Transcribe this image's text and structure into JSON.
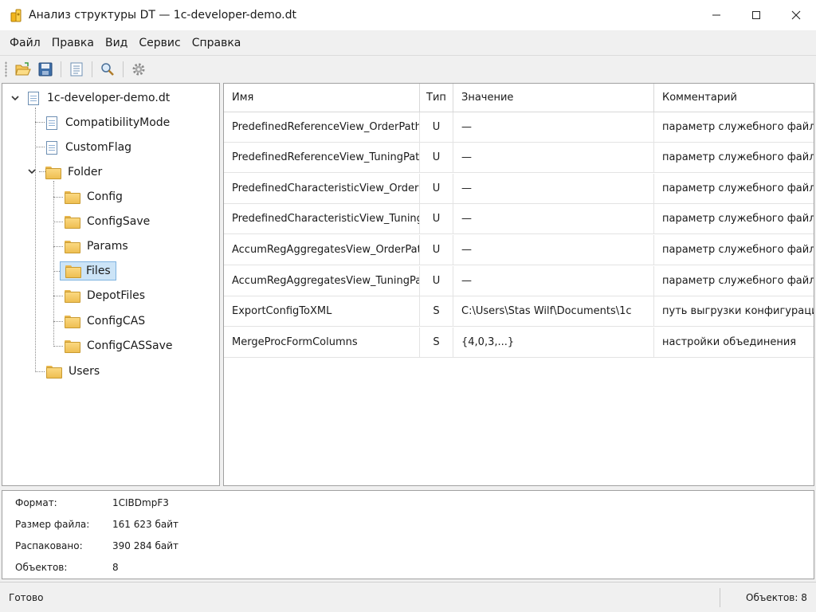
{
  "window": {
    "title": "Анализ структуры DT — 1c-developer-demo.dt"
  },
  "menu": [
    "Файл",
    "Правка",
    "Вид",
    "Сервис",
    "Справка"
  ],
  "toolbar": {
    "buttons": [
      "open-folder-icon",
      "save-icon",
      "list-icon",
      "search-icon",
      "gear-icon"
    ]
  },
  "tree": {
    "root": "1c-developer-demo.dt",
    "items": [
      {
        "label": "CompatibilityMode",
        "type": "doc"
      },
      {
        "label": "CustomFlag",
        "type": "doc"
      },
      {
        "label": "Folder",
        "type": "folder",
        "expanded": true,
        "children": [
          "Config",
          "ConfigSave",
          "Params",
          "Files",
          "DepotFiles",
          "ConfigCAS",
          "ConfigCASSave"
        ],
        "selected": "Files"
      },
      {
        "label": "Users",
        "type": "folder"
      }
    ]
  },
  "grid": {
    "columns": [
      "Имя",
      "Тип",
      "Значение",
      "Комментарий"
    ],
    "rows": [
      {
        "name": "PredefinedReferenceView_OrderPath",
        "type": "U",
        "value": "—",
        "comment": "параметр служебного файла"
      },
      {
        "name": "PredefinedReferenceView_TuningPath",
        "type": "U",
        "value": "—",
        "comment": "параметр служебного файла"
      },
      {
        "name": "PredefinedCharacteristicView_OrderPath",
        "type": "U",
        "value": "—",
        "comment": "параметр служебного файла"
      },
      {
        "name": "PredefinedCharacteristicView_TuningPath",
        "type": "U",
        "value": "—",
        "comment": "параметр служебного файла"
      },
      {
        "name": "AccumRegAggregatesView_OrderPath",
        "type": "U",
        "value": "—",
        "comment": "параметр служебного файла"
      },
      {
        "name": "AccumRegAggregatesView_TuningPath",
        "type": "U",
        "value": "—",
        "comment": "параметр служебного файла"
      },
      {
        "name": "ExportConfigToXML",
        "type": "S",
        "value": "C:\\Users\\Stas Wilf\\Documents\\1c",
        "comment": "путь выгрузки конфигурации"
      },
      {
        "name": "MergeProcFormColumns",
        "type": "S",
        "value": "{4,0,3,...}",
        "comment": "настройки объединения"
      }
    ]
  },
  "properties": [
    {
      "label": "Формат:",
      "value": "1CIBDmpF3"
    },
    {
      "label": "Размер файла:",
      "value": "161 623 байт"
    },
    {
      "label": "Распаковано:",
      "value": "390 284 байт"
    },
    {
      "label": "Объектов:",
      "value": "8"
    }
  ],
  "status": {
    "left": "Готово",
    "right": "Объектов: 8"
  },
  "colors": {
    "selection_bg": "#cce4f7",
    "selection_border": "#7fb3e0",
    "folder": "#f6c95e"
  }
}
